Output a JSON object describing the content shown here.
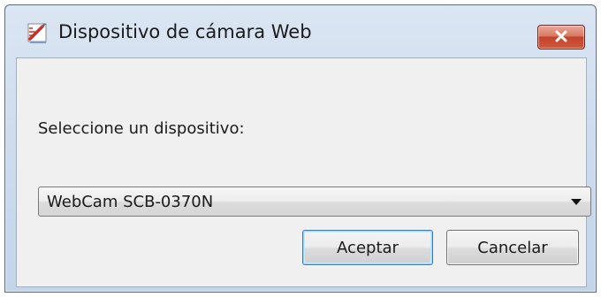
{
  "window": {
    "title": "Dispositivo de cámara Web",
    "icon": "pencil-ruler-icon"
  },
  "dialog": {
    "prompt": "Seleccione un dispositivo:",
    "device_select": {
      "selected": "WebCam SCB-0370N"
    },
    "buttons": {
      "ok_label": "Aceptar",
      "cancel_label": "Cancelar"
    }
  },
  "colors": {
    "titlebar_bg": "#cfddee",
    "client_bg": "#f0f0f0",
    "close_button": "#c2432b",
    "default_button_border": "#3c7fb1"
  }
}
